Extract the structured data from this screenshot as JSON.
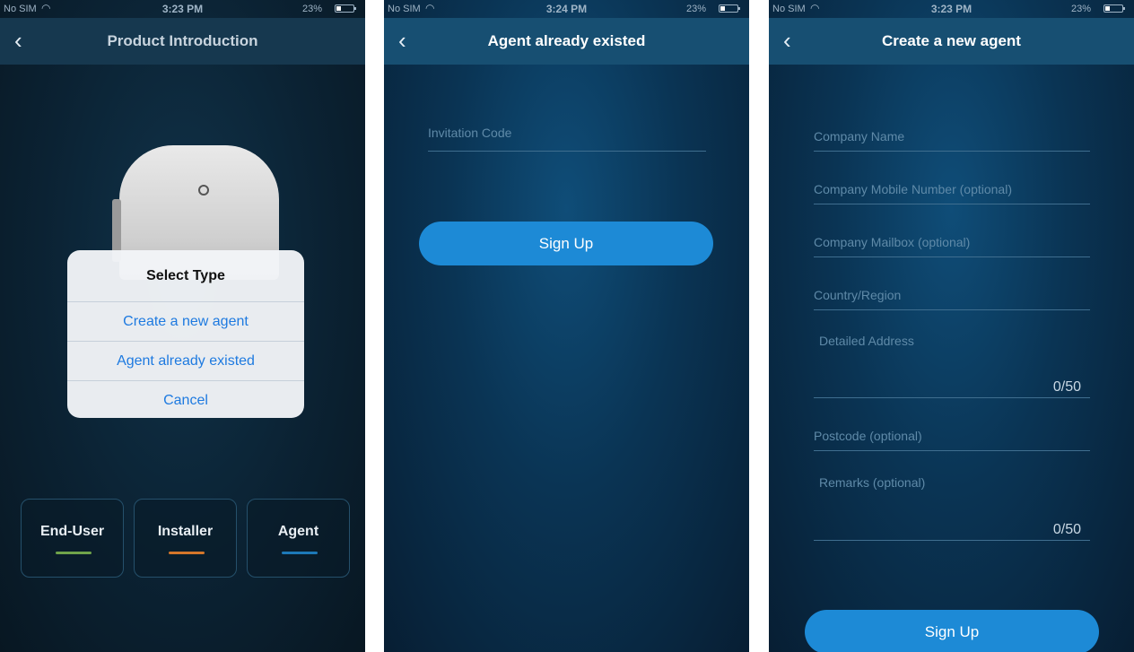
{
  "screens": [
    {
      "status": {
        "carrier": "No SIM",
        "time": "3:23 PM",
        "battery": "23%"
      },
      "nav": {
        "back": "‹",
        "title": "Product Introduction"
      },
      "dialog": {
        "title": "Select Type",
        "options": [
          "Create a new agent",
          "Agent already existed",
          "Cancel"
        ]
      },
      "roles": [
        {
          "label": "End-User",
          "color": "#6fa34a"
        },
        {
          "label": "Installer",
          "color": "#d5762a"
        },
        {
          "label": "Agent",
          "color": "#1d79b8"
        }
      ]
    },
    {
      "status": {
        "carrier": "No SIM",
        "time": "3:24 PM",
        "battery": "23%"
      },
      "nav": {
        "back": "‹",
        "title": "Agent already existed"
      },
      "invitation_placeholder": "Invitation Code",
      "submit_label": "Sign Up"
    },
    {
      "status": {
        "carrier": "No SIM",
        "time": "3:23 PM",
        "battery": "23%"
      },
      "nav": {
        "back": "‹",
        "title": "Create a new agent"
      },
      "fields": {
        "company_name": "Company Name",
        "company_mobile": "Company Mobile Number (optional)",
        "company_mailbox": "Company Mailbox (optional)",
        "country_region": "Country/Region",
        "detailed_address": "Detailed Address",
        "detailed_address_counter": "0/50",
        "postcode": "Postcode (optional)",
        "remarks": "Remarks (optional)",
        "remarks_counter": "0/50"
      },
      "submit_label": "Sign Up"
    }
  ],
  "colors": {
    "accent": "#1d8ad6",
    "dialog_link": "#1e7ae0"
  }
}
